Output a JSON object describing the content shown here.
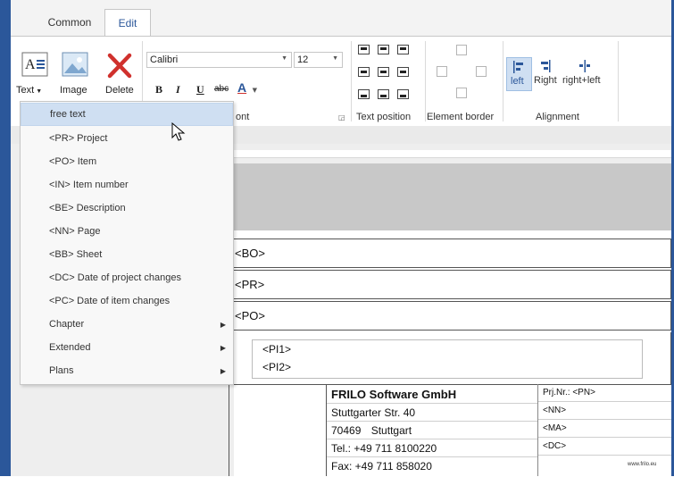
{
  "colors": {
    "accent": "#2b579a",
    "delete_red": "#d0312d",
    "selected_menu": "#cfdff2"
  },
  "tabs": [
    {
      "label": "Common"
    },
    {
      "label": "Edit"
    }
  ],
  "ribbon": {
    "text_button_label": "Text",
    "image_button_label": "Image",
    "delete_button_label": "Delete",
    "font_name": "Calibri",
    "font_size": "12",
    "bold_label": "B",
    "italic_label": "I",
    "underline_label": "U",
    "strike_label": "abc",
    "font_color_label": "A",
    "font_group_label": "ont",
    "text_position_label": "Text position",
    "element_border_label": "Element border",
    "alignment_label": "Alignment",
    "align_left_label": "left",
    "align_right_label": "Right",
    "align_rightleft_label": "right+left"
  },
  "menu": {
    "items": [
      {
        "label": "free text"
      },
      {
        "label": "<PR> Project"
      },
      {
        "label": "<PO> Item"
      },
      {
        "label": "<IN> Item number"
      },
      {
        "label": "<BE> Description"
      },
      {
        "label": "<NN> Page"
      },
      {
        "label": "<BB> Sheet"
      },
      {
        "label": "<DC> Date of project changes"
      },
      {
        "label": "<PC> Date of item changes"
      },
      {
        "label": "Chapter"
      },
      {
        "label": "Extended"
      },
      {
        "label": "Plans"
      }
    ]
  },
  "document": {
    "rows": [
      "<BO>",
      "<PR>",
      "<PO>"
    ],
    "inner_rows": [
      "<PI1>",
      "<PI2>"
    ],
    "company": {
      "name": "FRILO Software GmbH",
      "street": "Stuttgarter Str. 40",
      "zip": "70469",
      "city": "Stuttgart",
      "tel": "Tel.: +49 711 8100220",
      "fax": "Fax: +49 711 858020"
    },
    "meta": [
      "Prj.Nr.: <PN>",
      "<NN>",
      "<MA>",
      "<DC>"
    ],
    "website": "www.frilo.eu"
  }
}
